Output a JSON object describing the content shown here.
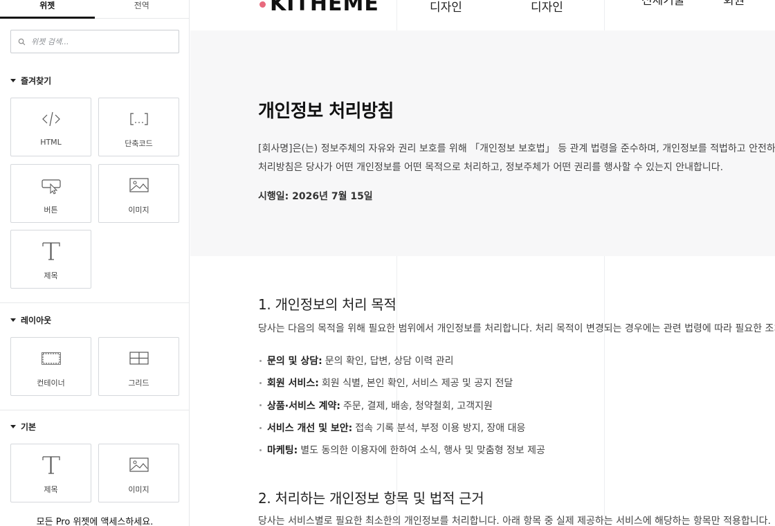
{
  "panel": {
    "tabs": [
      "위젯",
      "전역"
    ],
    "search_placeholder": "위젯 검색...",
    "categories": [
      {
        "title": "즐겨찾기",
        "widgets": [
          {
            "label": "HTML",
            "icon": "code-icon"
          },
          {
            "label": "단축코드",
            "icon": "shortcode-icon"
          },
          {
            "label": "버튼",
            "icon": "button-icon"
          },
          {
            "label": "이미지",
            "icon": "image-icon"
          },
          {
            "label": "제목",
            "icon": "heading-icon"
          }
        ]
      },
      {
        "title": "레이아웃",
        "widgets": [
          {
            "label": "컨테이너",
            "icon": "container-icon"
          },
          {
            "label": "그리드",
            "icon": "grid-icon"
          }
        ]
      },
      {
        "title": "기본",
        "widgets": [
          {
            "label": "제목",
            "icon": "heading-icon"
          },
          {
            "label": "이미지",
            "icon": "image-icon"
          }
        ]
      }
    ],
    "promo_text": "모든 Pro 위젯에 액세스하세요."
  },
  "site": {
    "logo_text": "KITHEME",
    "nav": [
      "디자인",
      "디자인",
      "전체기술",
      "회원"
    ]
  },
  "page": {
    "title": "개인정보 처리방침",
    "intro_line1": "[회사명]은(는) 정보주체의 자유와 권리 보호를 위해 「개인정보 보호법」 등 관계 법령을 준수하며, 개인정보를 적법하고 안전하게",
    "intro_line2": "처리방침은 당사가 어떤 개인정보를 어떤 목적으로 처리하고, 정보주체가 어떤 권리를 행사할 수 있는지 안내합니다.",
    "effective_date": "시행일: 2026년 7월 15일",
    "sections": [
      {
        "title": "1. 개인정보의 처리 목적",
        "desc": "당사는 다음의 목적을 위해 필요한 범위에서 개인정보를 처리합니다. 처리 목적이 변경되는 경우에는 관련 법령에 따라 필요한 조치를",
        "bullets": [
          {
            "term": "문의 및 상담:",
            "text": "문의 확인, 답변, 상담 이력 관리"
          },
          {
            "term": "회원 서비스:",
            "text": "회원 식별, 본인 확인, 서비스 제공 및 공지 전달"
          },
          {
            "term": "상품·서비스 계약:",
            "text": "주문, 결제, 배송, 청약철회, 고객지원"
          },
          {
            "term": "서비스 개선 및 보안:",
            "text": "접속 기록 분석, 부정 이용 방지, 장애 대응"
          },
          {
            "term": "마케팅:",
            "text": "별도 동의한 이용자에 한하여 소식, 행사 및 맞춤형 정보 제공"
          }
        ]
      },
      {
        "title": "2. 처리하는 개인정보 항목 및 법적 근거",
        "desc": "당사는 서비스별로 필요한 최소한의 개인정보를 처리합니다. 아래 항목 중 실제 제공하는 서비스에 해당하는 항목만 적용합니다."
      }
    ]
  }
}
